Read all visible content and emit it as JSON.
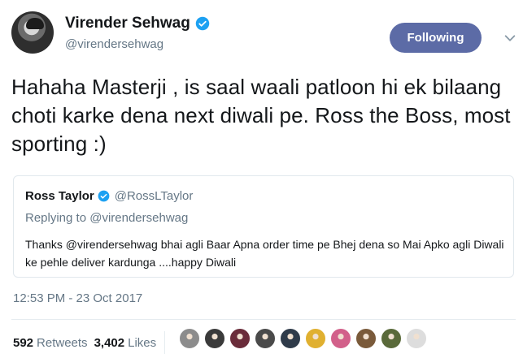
{
  "author": {
    "display_name": "Virender Sehwag",
    "handle": "@virendersehwag",
    "verified_icon": "verified-badge-icon"
  },
  "follow_button": {
    "label": "Following"
  },
  "menu_icon": "chevron-down-icon",
  "tweet": {
    "text": "Hahaha Masterji , is saal waali patloon hi ek bilaang choti karke dena next diwali pe. Ross the Boss, most sporting :)"
  },
  "quoted_tweet": {
    "display_name": "Ross Taylor",
    "handle": "@RossLTaylor",
    "replying_label": "Replying to",
    "replying_handle": "@virendersehwag",
    "text": "Thanks @virendersehwag bhai agli Baar Apna order time pe Bhej dena so Mai Apko agli Diwali ke pehle deliver  kardunga ....happy Diwali"
  },
  "timestamp": "12:53 PM - 23 Oct 2017",
  "stats": {
    "retweets_count": "592",
    "retweets_label": "Retweets",
    "likes_count": "3,402",
    "likes_label": "Likes"
  },
  "colors": {
    "follow_bg": "#5c6ba6",
    "verified": "#1da1f2",
    "muted_text": "#657786"
  },
  "likers": [
    {
      "color": "#8c8c8c"
    },
    {
      "color": "#3a3a3a"
    },
    {
      "color": "#6a2c3a"
    },
    {
      "color": "#4a4a4a"
    },
    {
      "color": "#2f3b4a"
    },
    {
      "color": "#e0b030"
    },
    {
      "color": "#d2608a"
    },
    {
      "color": "#7a5a3a"
    },
    {
      "color": "#5a6a3a"
    },
    {
      "color": "#dddddd"
    }
  ]
}
